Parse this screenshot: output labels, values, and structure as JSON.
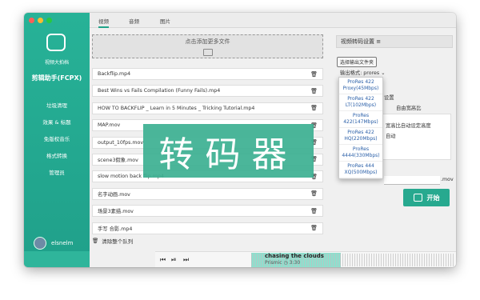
{
  "sidebar": {
    "logo_label": "视频大拍档",
    "app_title": "剪辑助手(FCPX)",
    "nav": [
      "垃圾清理",
      "效果 & 标题",
      "免版权音乐",
      "格式转换",
      "管理员"
    ],
    "username": "elsnelm"
  },
  "tabs": [
    "视频",
    "音频",
    "图片"
  ],
  "dropzone": {
    "text": "点击添加更多文件"
  },
  "files": [
    "Backflip.mp4",
    "Best Wins vs Fails Compilation (Funny Fails).mp4",
    "HOW TO BACKFLIP _ Learn in 5 Minutes _ Tricking Tutorial.mp4",
    "MAP.mov",
    "output_10fps.mov",
    "scene3假象.mov",
    "slow motion back flip.mp4",
    "名字动画.mov",
    "场景3素描.mov",
    "手写 合影.mp4"
  ],
  "clear_label": "清除整个队列",
  "settings": {
    "header": "视频转码设置",
    "choose_folder": "选择输出文件夹",
    "output_format_label": "输出格式: prores",
    "options": [
      "ProRes 422 Proxy(45Mbps)",
      "ProRes 422 LT(102Mbps)",
      "ProRes 422(147Mbps)",
      "ProRes 422 HQ(220Mbps)",
      "ProRes 4444(330Mbps)",
      "ProRes 444 XQ(500Mbps)"
    ],
    "label_settings": "设置",
    "label_custom_ratio": "自由宽高比",
    "label_ratio_auto": "宽高比自动设定高度",
    "label_auto": "自动",
    "ext": ".mov",
    "start": "开始"
  },
  "overlay_text": "转码器",
  "player": {
    "song": "chasing the clouds",
    "artist": "Prismic",
    "time": "3:30"
  }
}
